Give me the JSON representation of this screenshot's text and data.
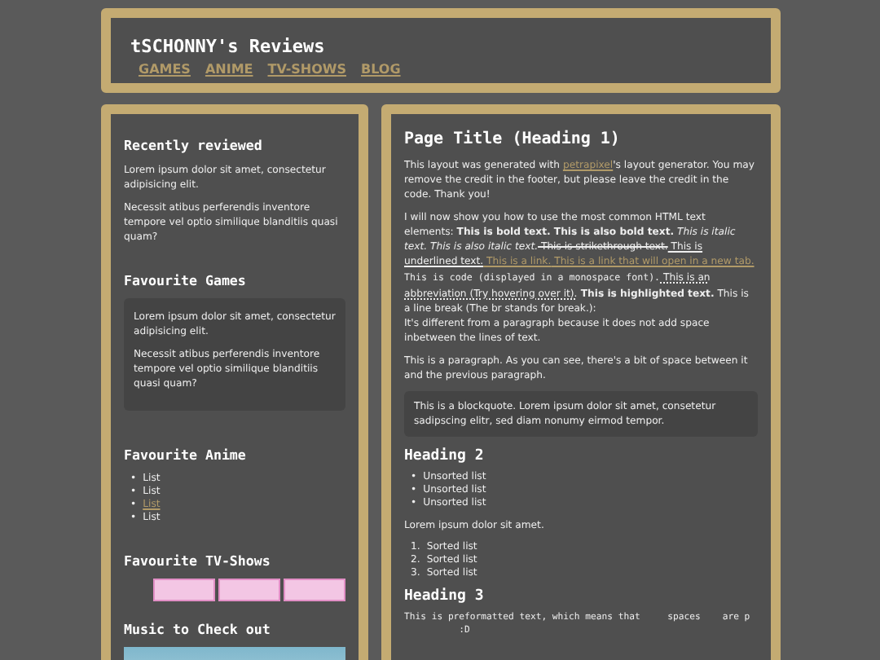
{
  "header": {
    "title": "tSCHONNY's Reviews",
    "nav": [
      {
        "label": "GAMES"
      },
      {
        "label": "ANIME"
      },
      {
        "label": "TV-SHOWS"
      },
      {
        "label": "BLOG"
      }
    ]
  },
  "sidebar": {
    "sections": [
      {
        "kind": "text",
        "heading": "Recently reviewed",
        "paragraphs": [
          "Lorem ipsum dolor sit amet, consectetur adipisicing elit.",
          "Necessit atibus perferendis inventore tempore vel optio similique blanditiis quasi quam?"
        ]
      },
      {
        "kind": "box",
        "heading": "Favourite Games",
        "paragraphs": [
          "Lorem ipsum dolor sit amet, consectetur adipisicing elit.",
          "Necessit atibus perferendis inventore tempore vel optio similique blanditiis quasi quam?"
        ]
      },
      {
        "kind": "list",
        "heading": "Favourite Anime",
        "items": [
          {
            "kind": "text",
            "marker": "•",
            "text": "List"
          },
          {
            "kind": "text",
            "marker": "•",
            "text": "List"
          },
          {
            "kind": "link",
            "marker": "•",
            "text": "List"
          },
          {
            "kind": "text",
            "marker": "•",
            "text": "List"
          }
        ]
      },
      {
        "kind": "badges",
        "heading": "Favourite TV-Shows",
        "badges": [
          {
            "kind": "image"
          },
          {
            "kind": "image"
          },
          {
            "kind": "image"
          }
        ]
      },
      {
        "kind": "photo",
        "heading": "Music to Check out"
      }
    ]
  },
  "main": {
    "title": "Page Title (Heading 1)",
    "credit": [
      {
        "kind": "text",
        "text": "This layout was generated with "
      },
      {
        "kind": "link",
        "text": "petrapixel"
      },
      {
        "kind": "text",
        "text": "'s layout generator. You may remove the credit in the footer, but please leave the credit in the code. Thank you!"
      }
    ],
    "elements": [
      {
        "kind": "text",
        "text": "I will now show you how to use the most common HTML text elements: "
      },
      {
        "kind": "bold",
        "text": "This is bold text. This is also bold text."
      },
      {
        "kind": "italic",
        "text": " This is italic text. This is also italic text."
      },
      {
        "kind": "strike",
        "text": " This is strikethrough text."
      },
      {
        "kind": "underline",
        "text": " This is underlined text."
      },
      {
        "kind": "link",
        "text": " This is a link."
      },
      {
        "kind": "link",
        "text": " This is a link that will open in a new tab."
      },
      {
        "kind": "code",
        "text": " This is code (displayed in a monospace font)."
      },
      {
        "kind": "abbr",
        "text": " This is an abbreviation (Try hovering over it)."
      },
      {
        "kind": "mark",
        "text": " This is highlighted text."
      },
      {
        "kind": "text",
        "text": " This is a line break (The br stands for break.):"
      },
      {
        "kind": "br"
      },
      {
        "kind": "text",
        "text": "It's different from a paragraph because it does not add space inbetween the lines of text."
      }
    ],
    "paragraph": "This is a paragraph. As you can see, there's a bit of space between it and the previous paragraph.",
    "blockquote": "This is a blockquote. Lorem ipsum dolor sit amet, consetetur sadipscing elitr, sed diam nonumy eirmod tempor.",
    "heading2": "Heading 2",
    "unsorted": [
      {
        "marker": "•",
        "text": "Unsorted list"
      },
      {
        "marker": "•",
        "text": "Unsorted list"
      },
      {
        "marker": "•",
        "text": "Unsorted list"
      }
    ],
    "lorem": "Lorem ipsum dolor sit amet.",
    "sorted": [
      {
        "marker": "1.",
        "text": "Sorted list"
      },
      {
        "marker": "2.",
        "text": "Sorted list"
      },
      {
        "marker": "3.",
        "text": "Sorted list"
      }
    ],
    "heading3": "Heading 3",
    "pre": "This is preformatted text, which means that     spaces    are p\n          :D"
  }
}
